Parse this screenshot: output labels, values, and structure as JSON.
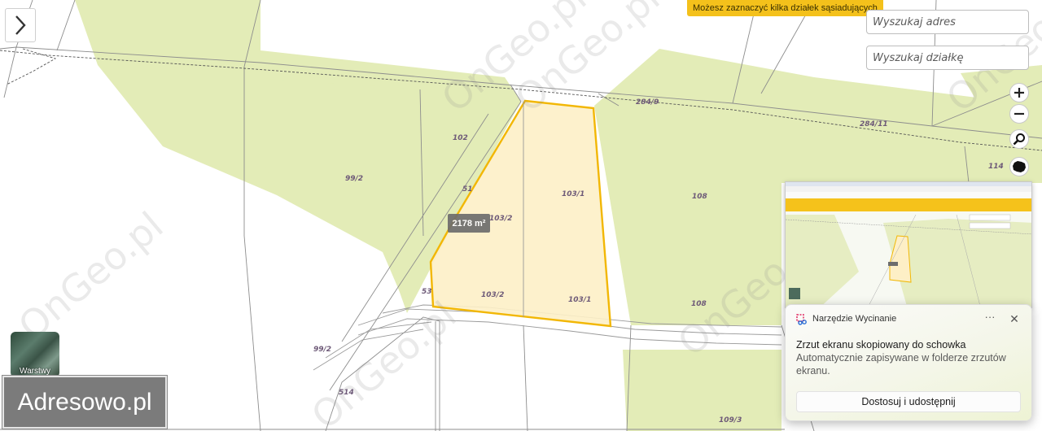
{
  "hint": "Możesz zaznaczyć kilka działek sąsiadujących",
  "search": {
    "address_placeholder": "Wyszukaj adres",
    "parcel_placeholder": "Wyszukaj działkę"
  },
  "map": {
    "watermark": "OnGeo.pl",
    "area_label": "2178 m²",
    "layers_label": "Warstwy",
    "brand": "Adresowo.pl",
    "parcels": [
      {
        "id": "284-9",
        "label": "284/9"
      },
      {
        "id": "284-11",
        "label": "284/11"
      },
      {
        "id": "114",
        "label": "114"
      },
      {
        "id": "102",
        "label": "102"
      },
      {
        "id": "99-2-a",
        "label": "99/2"
      },
      {
        "id": "51",
        "label": "51"
      },
      {
        "id": "103-2-a",
        "label": "103/2"
      },
      {
        "id": "103-1-a",
        "label": "103/1"
      },
      {
        "id": "108-a",
        "label": "108"
      },
      {
        "id": "53",
        "label": "53"
      },
      {
        "id": "103-2-b",
        "label": "103/2"
      },
      {
        "id": "103-1-b",
        "label": "103/1"
      },
      {
        "id": "108-b",
        "label": "108"
      },
      {
        "id": "99-2-b",
        "label": "99/2"
      },
      {
        "id": "514",
        "label": "514"
      },
      {
        "id": "109-3",
        "label": "109/3"
      }
    ],
    "colors": {
      "vegetation": "#e3ecb7",
      "selection_fill": "#fdefc6",
      "selection_stroke": "#f2b705",
      "hint_bg": "#f4c11b"
    }
  },
  "notification": {
    "app_name": "Narzędzie Wycinanie",
    "title": "Zrzut ekranu skopiowany do schowka",
    "body": "Automatycznie zapisywane w folderze zrzutów ekranu.",
    "action": "Dostosuj i udostępnij",
    "more": "···",
    "close": "✕"
  },
  "icons": [
    "chevron-right-icon",
    "zoom-in-icon",
    "zoom-out-icon",
    "search-icon",
    "poland-map-icon",
    "snipping-tool-icon",
    "more-icon",
    "close-icon"
  ]
}
